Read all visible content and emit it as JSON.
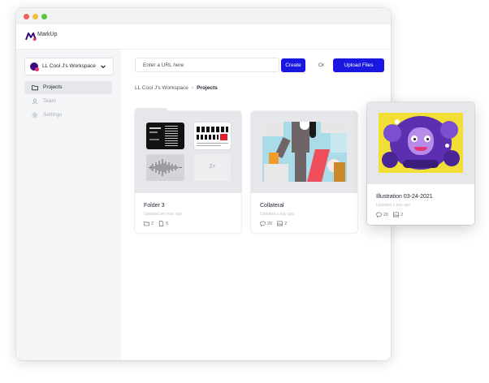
{
  "app": {
    "name": "MarkUp"
  },
  "sidebar": {
    "workspace_name": "LL Cool J's Workspace",
    "items": [
      {
        "label": "Projects"
      },
      {
        "label": "Team"
      },
      {
        "label": "Settings"
      }
    ]
  },
  "toolbar": {
    "url_placeholder": "Enter a URL here",
    "create_label": "Create",
    "or_label": "Or",
    "upload_label": "Upload Files"
  },
  "breadcrumb": {
    "workspace": "LL Cool J's Workspace",
    "current": "Projects"
  },
  "cards": [
    {
      "title": "Folder 3",
      "updated": "Updated an hour ago",
      "stat1": "2",
      "stat2": "5",
      "more_count": "2+"
    },
    {
      "title": "Collateral",
      "updated": "Updated a day ago",
      "stat1": "20",
      "stat2": "2"
    },
    {
      "title": "Illustration 03-24-2021",
      "updated": "Updated a day ago",
      "stat1": "20",
      "stat2": "2"
    }
  ],
  "colors": {
    "accent": "#1a17e0",
    "sidebar_bg": "#f4f5f7",
    "illustration_bg": "#f2df36",
    "illustration_purple": "#5b2fb0"
  }
}
